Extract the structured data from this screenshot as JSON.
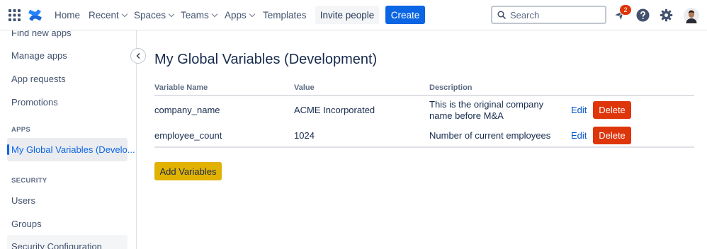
{
  "topbar": {
    "icons": {
      "app_switcher": "grid-icon",
      "logo": "confluence-logo-icon"
    },
    "nav": [
      {
        "label": "Home",
        "has_dropdown": false
      },
      {
        "label": "Recent",
        "has_dropdown": true
      },
      {
        "label": "Spaces",
        "has_dropdown": true
      },
      {
        "label": "Teams",
        "has_dropdown": true
      },
      {
        "label": "Apps",
        "has_dropdown": true
      },
      {
        "label": "Templates",
        "has_dropdown": false
      }
    ],
    "invite_label": "Invite people",
    "create_label": "Create",
    "search_placeholder": "Search",
    "notification_count": "2",
    "right_icons": [
      "notification-icon",
      "help-icon",
      "settings-icon",
      "avatar"
    ]
  },
  "sidebar": {
    "items_top": [
      "Find new apps",
      "Manage apps",
      "App requests",
      "Promotions"
    ],
    "apps_heading": "APPS",
    "apps_selected": "My Global Variables (Develo...",
    "security_heading": "SECURITY",
    "security_items": [
      "Users",
      "Groups",
      "Security Configuration"
    ]
  },
  "main": {
    "title": "My Global Variables (Development)",
    "table": {
      "headers": [
        "Variable Name",
        "Value",
        "Description"
      ],
      "rows": [
        {
          "name": "company_name",
          "value": "ACME Incorporated",
          "description_line1": "This is the original company",
          "description_line2": "name before M&A",
          "edit": "Edit",
          "delete": "Delete"
        },
        {
          "name": "employee_count",
          "value": "1024",
          "description_line1": "Number of current employees",
          "edit": "Edit",
          "delete": "Delete"
        }
      ]
    },
    "add_button": "Add Variables"
  },
  "colors": {
    "primary_blue": "#0c66e4",
    "delete_red": "#de350b",
    "add_yellow": "#e2b203",
    "link_blue": "#0052cc",
    "text": "#172b4d"
  }
}
